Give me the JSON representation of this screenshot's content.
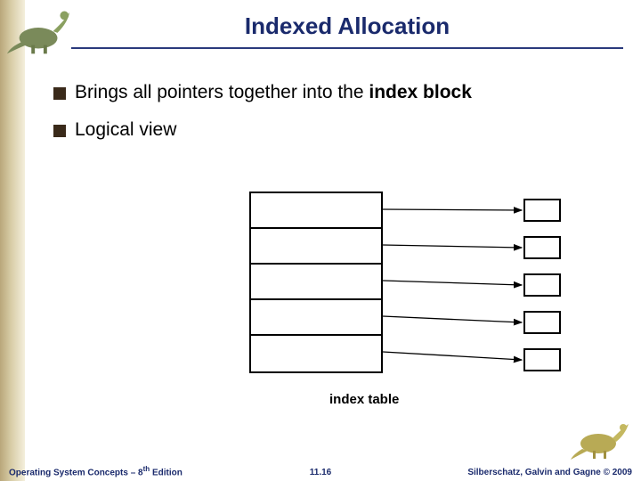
{
  "title": "Indexed Allocation",
  "bullets": [
    {
      "pre": "Brings all pointers together into the ",
      "bold": "index block"
    },
    {
      "pre": "Logical view",
      "bold": ""
    }
  ],
  "diagram": {
    "index_rows": 5,
    "blocks": 5,
    "caption": "index table"
  },
  "footer": {
    "left_pre": "Operating System Concepts – 8",
    "left_sup": "th",
    "left_post": " Edition",
    "center": "11.16",
    "right": "Silberschatz, Galvin and Gagne © 2009"
  }
}
